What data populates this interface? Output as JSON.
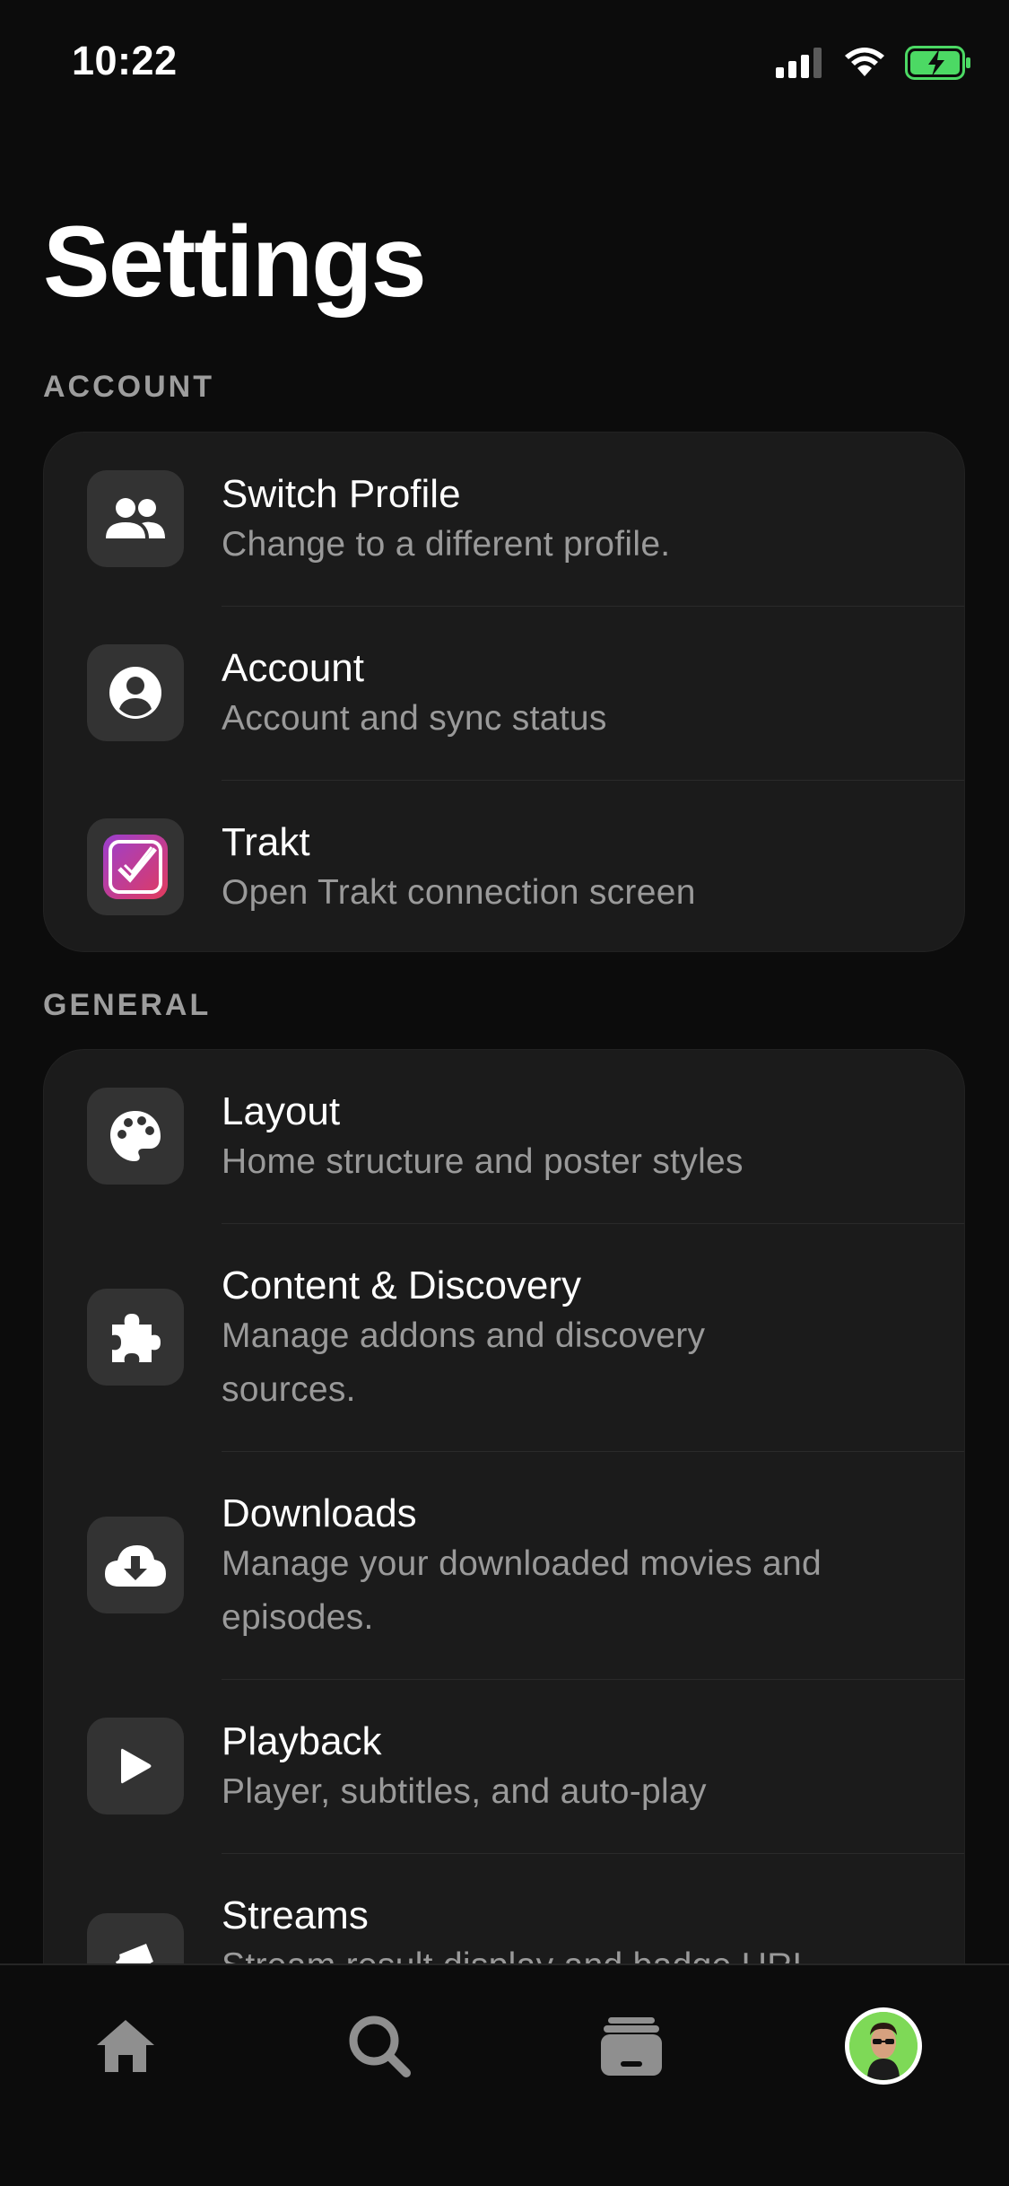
{
  "status_bar": {
    "time": "10:22"
  },
  "page": {
    "title": "Settings"
  },
  "sections": {
    "account": {
      "header": "ACCOUNT",
      "items": [
        {
          "title": "Switch Profile",
          "subtitle": "Change to a different profile.",
          "icon": "people-icon"
        },
        {
          "title": "Account",
          "subtitle": "Account and sync status",
          "icon": "user-circle-icon"
        },
        {
          "title": "Trakt",
          "subtitle": "Open Trakt connection screen",
          "icon": "trakt-logo-icon"
        }
      ]
    },
    "general": {
      "header": "GENERAL",
      "items": [
        {
          "title": "Layout",
          "subtitle": "Home structure and poster styles",
          "icon": "palette-icon"
        },
        {
          "title": "Content & Discovery",
          "subtitle": "Manage addons and discovery sources.",
          "icon": "puzzle-icon"
        },
        {
          "title": "Downloads",
          "subtitle": "Manage your downloaded movies and episodes.",
          "icon": "cloud-download-icon"
        },
        {
          "title": "Playback",
          "subtitle": "Player, subtitles, and auto-play",
          "icon": "play-icon"
        },
        {
          "title": "Streams",
          "subtitle": "Stream result display and badge URL",
          "icon": "ticket-icon"
        }
      ]
    }
  },
  "tab_bar": {
    "tabs": [
      {
        "name": "Home",
        "icon": "home-icon"
      },
      {
        "name": "Search",
        "icon": "search-icon"
      },
      {
        "name": "Library",
        "icon": "library-icon"
      },
      {
        "name": "Profile",
        "icon": "avatar"
      }
    ]
  },
  "colors": {
    "background": "#0c0c0c",
    "card": "#1b1b1b",
    "icon_tile": "#333333",
    "subtitle": "#9a9a9a",
    "battery_fill": "#4cd964",
    "trakt_accent": "#c43a8f"
  }
}
